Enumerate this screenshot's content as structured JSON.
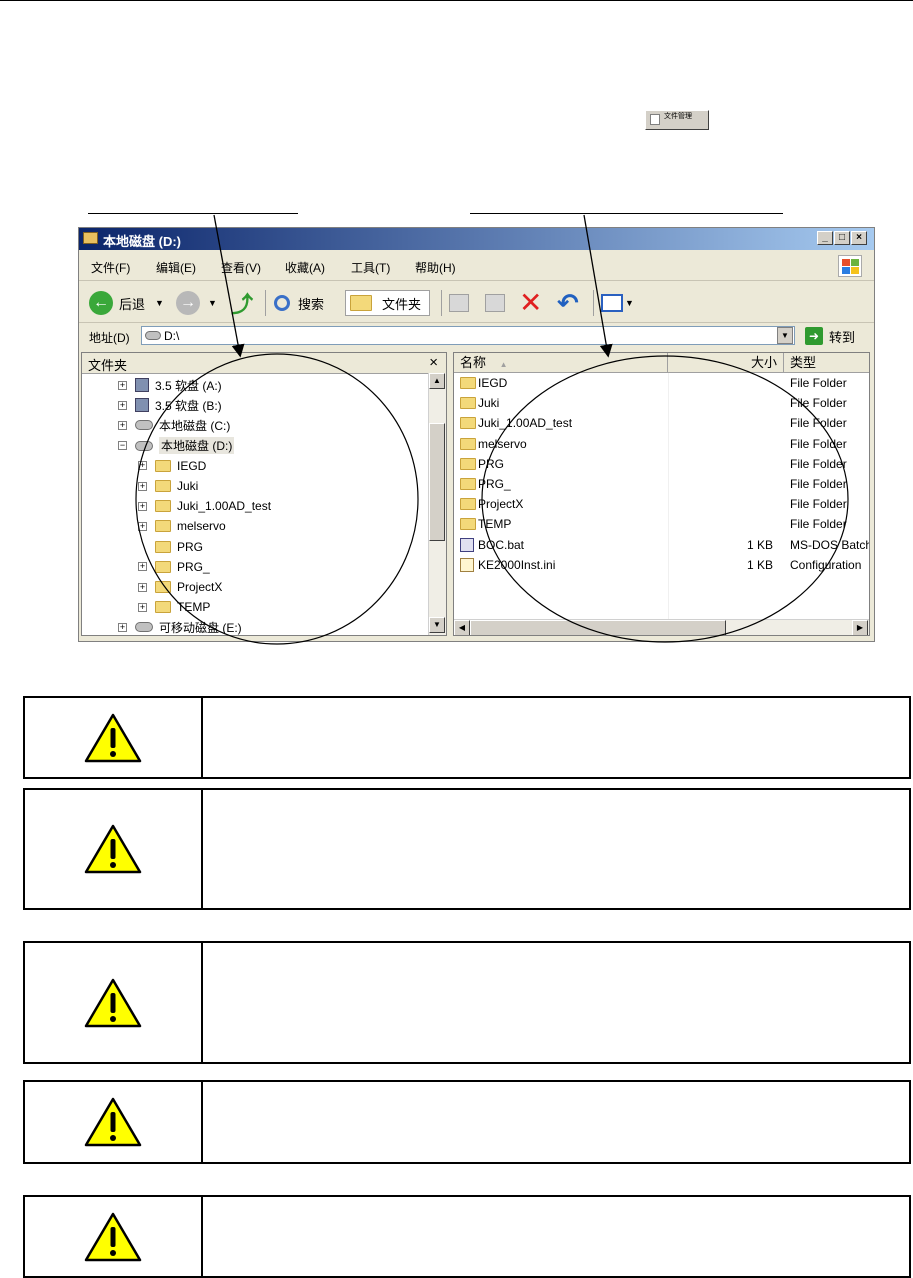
{
  "page": {
    "mini_button_label": "文件管理"
  },
  "explorer": {
    "title": "本地磁盘 (D:)",
    "menu": [
      "文件(F)",
      "编辑(E)",
      "查看(V)",
      "收藏(A)",
      "工具(T)",
      "帮助(H)"
    ],
    "toolbar": {
      "back": "后退",
      "search": "搜索",
      "folders": "文件夹"
    },
    "address": {
      "label": "地址(D)",
      "value": "D:\\",
      "go": "转到"
    },
    "left_pane": {
      "title": "文件夹",
      "close": "×",
      "tree": [
        {
          "label": "3.5 软盘 (A:)",
          "kind": "floppy",
          "expand": "+"
        },
        {
          "label": "3.5 软盘 (B:)",
          "kind": "floppy",
          "expand": "+"
        },
        {
          "label": "本地磁盘 (C:)",
          "kind": "drive",
          "expand": "+"
        },
        {
          "label": "本地磁盘 (D:)",
          "kind": "drive",
          "expand": "−",
          "selected": true
        },
        {
          "label": "IEGD",
          "kind": "folder",
          "expand": "+"
        },
        {
          "label": "Juki",
          "kind": "folder",
          "expand": "+"
        },
        {
          "label": "Juki_1.00AD_test",
          "kind": "folder",
          "expand": "+"
        },
        {
          "label": "melservo",
          "kind": "folder",
          "expand": "+"
        },
        {
          "label": "PRG",
          "kind": "folder",
          "expand": ""
        },
        {
          "label": "PRG_",
          "kind": "folder",
          "expand": "+"
        },
        {
          "label": "ProjectX",
          "kind": "folder",
          "expand": "+"
        },
        {
          "label": "TEMP",
          "kind": "folder",
          "expand": "+"
        },
        {
          "label": "可移动磁盘 (E:)",
          "kind": "drive",
          "expand": "+"
        }
      ]
    },
    "right_pane": {
      "columns": {
        "name": "名称",
        "size": "大小",
        "type": "类型"
      },
      "files": [
        {
          "name": "IEGD",
          "size": "",
          "type": "File Folder",
          "icon": "folder"
        },
        {
          "name": "Juki",
          "size": "",
          "type": "File Folder",
          "icon": "folder"
        },
        {
          "name": "Juki_1.00AD_test",
          "size": "",
          "type": "File Folder",
          "icon": "folder"
        },
        {
          "name": "melservo",
          "size": "",
          "type": "File Folder",
          "icon": "folder"
        },
        {
          "name": "PRG",
          "size": "",
          "type": "File Folder",
          "icon": "folder"
        },
        {
          "name": "PRG_",
          "size": "",
          "type": "File Folder",
          "icon": "folder"
        },
        {
          "name": "ProjectX",
          "size": "",
          "type": "File Folder",
          "icon": "folder"
        },
        {
          "name": "TEMP",
          "size": "",
          "type": "File Folder",
          "icon": "folder"
        },
        {
          "name": "BOC.bat",
          "size": "1 KB",
          "type": "MS-DOS Batch",
          "icon": "bat"
        },
        {
          "name": "KE2000Inst.ini",
          "size": "1 KB",
          "type": "Configuration",
          "icon": "ini"
        }
      ]
    }
  },
  "colors": {
    "title_start": "#0a246a",
    "title_end": "#a6caf0",
    "warning_fill": "#ffff00",
    "window_bg": "#ece9d8"
  },
  "warnings": [
    {
      "icon": "warning-triangle-icon"
    },
    {
      "icon": "warning-triangle-icon"
    },
    {
      "icon": "warning-triangle-icon"
    },
    {
      "icon": "warning-triangle-icon"
    },
    {
      "icon": "warning-triangle-icon"
    }
  ]
}
